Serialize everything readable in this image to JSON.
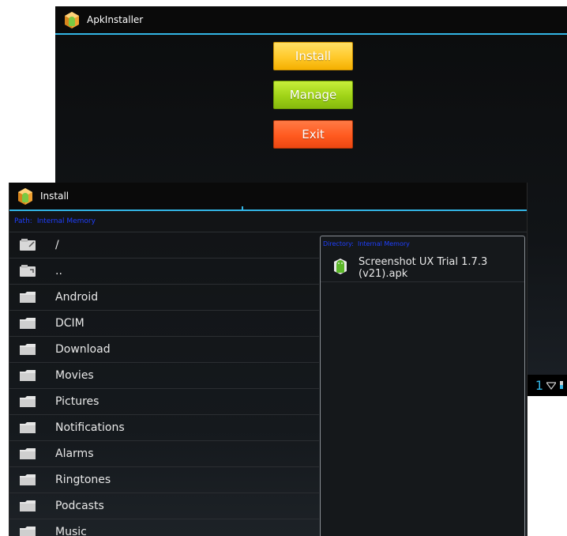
{
  "main_window": {
    "title": "ApkInstaller",
    "buttons": {
      "install": "Install",
      "manage": "Manage",
      "exit": "Exit"
    },
    "status_bar": {
      "clock_fragment": "1"
    }
  },
  "install_window": {
    "title": "Install",
    "path": {
      "label": "Path:",
      "value": "Internal Memory"
    },
    "files": [
      {
        "name": "/",
        "kind": "storage"
      },
      {
        "name": "..",
        "kind": "storage"
      },
      {
        "name": "Android",
        "kind": "folder"
      },
      {
        "name": "DCIM",
        "kind": "folder"
      },
      {
        "name": "Download",
        "kind": "folder"
      },
      {
        "name": "Movies",
        "kind": "folder"
      },
      {
        "name": "Pictures",
        "kind": "folder"
      },
      {
        "name": "Notifications",
        "kind": "folder"
      },
      {
        "name": "Alarms",
        "kind": "folder"
      },
      {
        "name": "Ringtones",
        "kind": "folder"
      },
      {
        "name": "Podcasts",
        "kind": "folder"
      },
      {
        "name": "Music",
        "kind": "folder"
      }
    ],
    "side_panel": {
      "directory": {
        "label": "Directory:",
        "value": "Internal Memory"
      },
      "apk_name": "Screenshot UX Trial 1.7.3 (v21).apk"
    }
  },
  "colors": {
    "accent": "#33b5e5",
    "path_text": "#1f3fff",
    "install_button": "#ffc92a",
    "manage_button": "#9fd317",
    "exit_button": "#ff5a1f"
  },
  "icons": {
    "app": "apkinstaller-app-icon",
    "storage": "storage-card-icon",
    "folder": "folder-icon",
    "apk": "android-apk-icon",
    "wifi": "wifi-icon",
    "battery": "battery-icon"
  }
}
